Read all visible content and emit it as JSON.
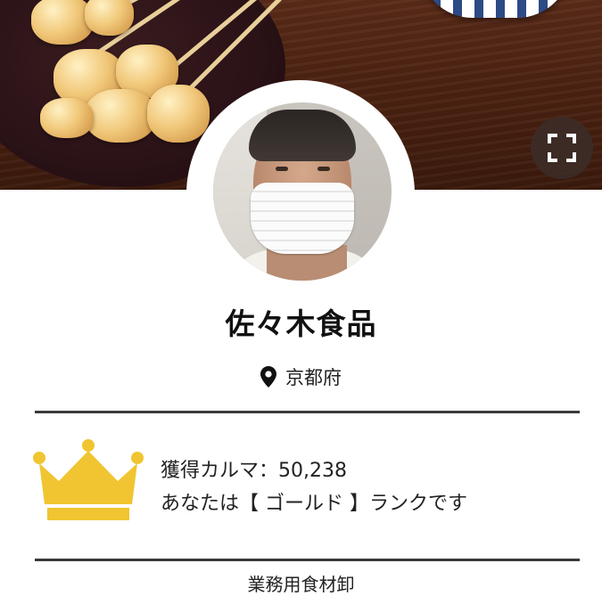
{
  "profile": {
    "shop_name": "佐々木食品",
    "location": "京都府",
    "karma_line": "獲得カルマ：50,238",
    "rank_line": "あなたは【 ゴールド 】ランクです",
    "category": "業務用食材卸"
  },
  "icons": {
    "expand": "expand-icon",
    "location": "map-pin-icon",
    "rank": "crown-icon"
  },
  "colors": {
    "crown_gold": "#f0c531",
    "divider": "#3a3a3a",
    "text": "#222222"
  }
}
